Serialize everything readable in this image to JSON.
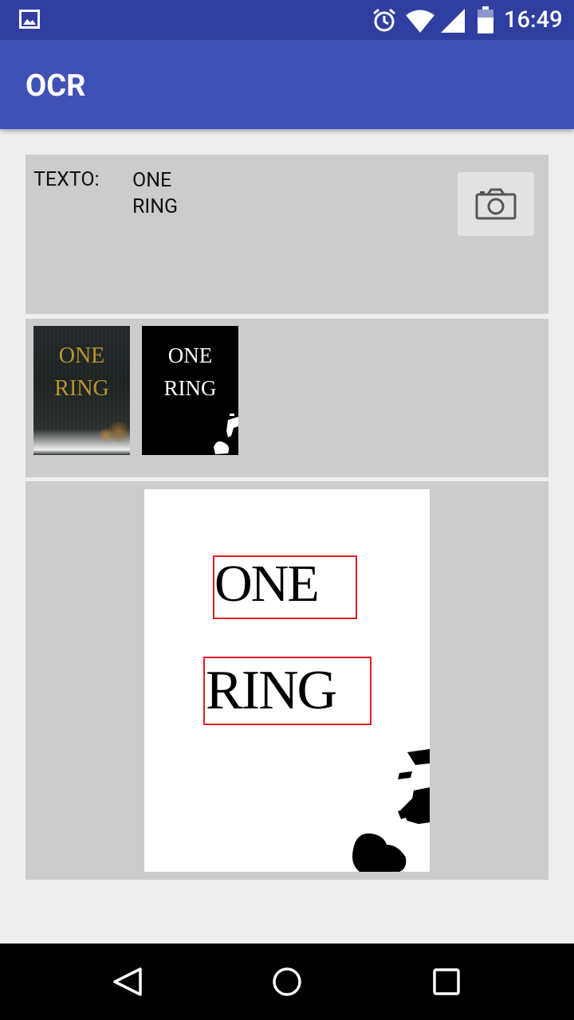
{
  "status_bar": {
    "time": "16:49",
    "icons": [
      "gallery-notification-icon",
      "alarm-icon",
      "wifi-icon",
      "signal-icon",
      "battery-icon"
    ]
  },
  "app_bar": {
    "title": "OCR"
  },
  "text_panel": {
    "label": "TEXTO:",
    "value": "ONE\nRING",
    "camera_icon": "camera-icon"
  },
  "thumbnails": {
    "original": {
      "line1": "ONE",
      "line2": "RING"
    },
    "binarized": {
      "line1": "ONE",
      "line2": "RING"
    }
  },
  "result": {
    "words": [
      "ONE",
      "RING"
    ],
    "box_color": "#e51c23"
  },
  "nav_bar": {
    "icons": [
      "back-icon",
      "home-icon",
      "recents-icon"
    ]
  },
  "colors": {
    "primary": "#3f51b5",
    "primary_dark": "#303f9f",
    "panel": "#cccccc",
    "background": "#eeeeee"
  }
}
